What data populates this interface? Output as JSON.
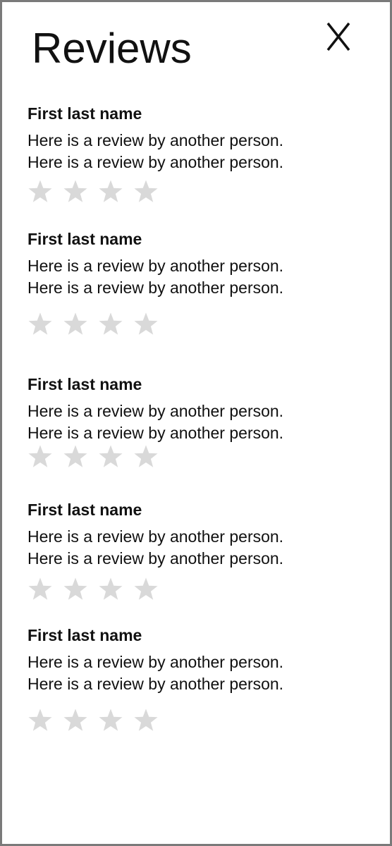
{
  "header": {
    "title": "Reviews",
    "close_label": "X"
  },
  "reviews": [
    {
      "name": "First last name",
      "lines": [
        "Here is a review by another person.",
        "Here is a review by another person."
      ],
      "rating": 0,
      "stars_shown": 4
    },
    {
      "name": "First last name",
      "lines": [
        "Here is a review by another person.",
        "Here is a review by another person."
      ],
      "rating": 0,
      "stars_shown": 4
    },
    {
      "name": "First last name",
      "lines": [
        "Here is a review by another person.",
        "Here is a review by another person."
      ],
      "rating": 0,
      "stars_shown": 4
    },
    {
      "name": "First last name",
      "lines": [
        "Here is a review by another person.",
        "Here is a review by another person."
      ],
      "rating": 0,
      "stars_shown": 4
    },
    {
      "name": "First last name",
      "lines": [
        "Here is a review by another person.",
        "Here is a review by another person."
      ],
      "rating": 0,
      "stars_shown": 4
    }
  ],
  "colors": {
    "text": "#111111",
    "star_empty": "#d9d9d9",
    "border": "#7a7a7a"
  }
}
